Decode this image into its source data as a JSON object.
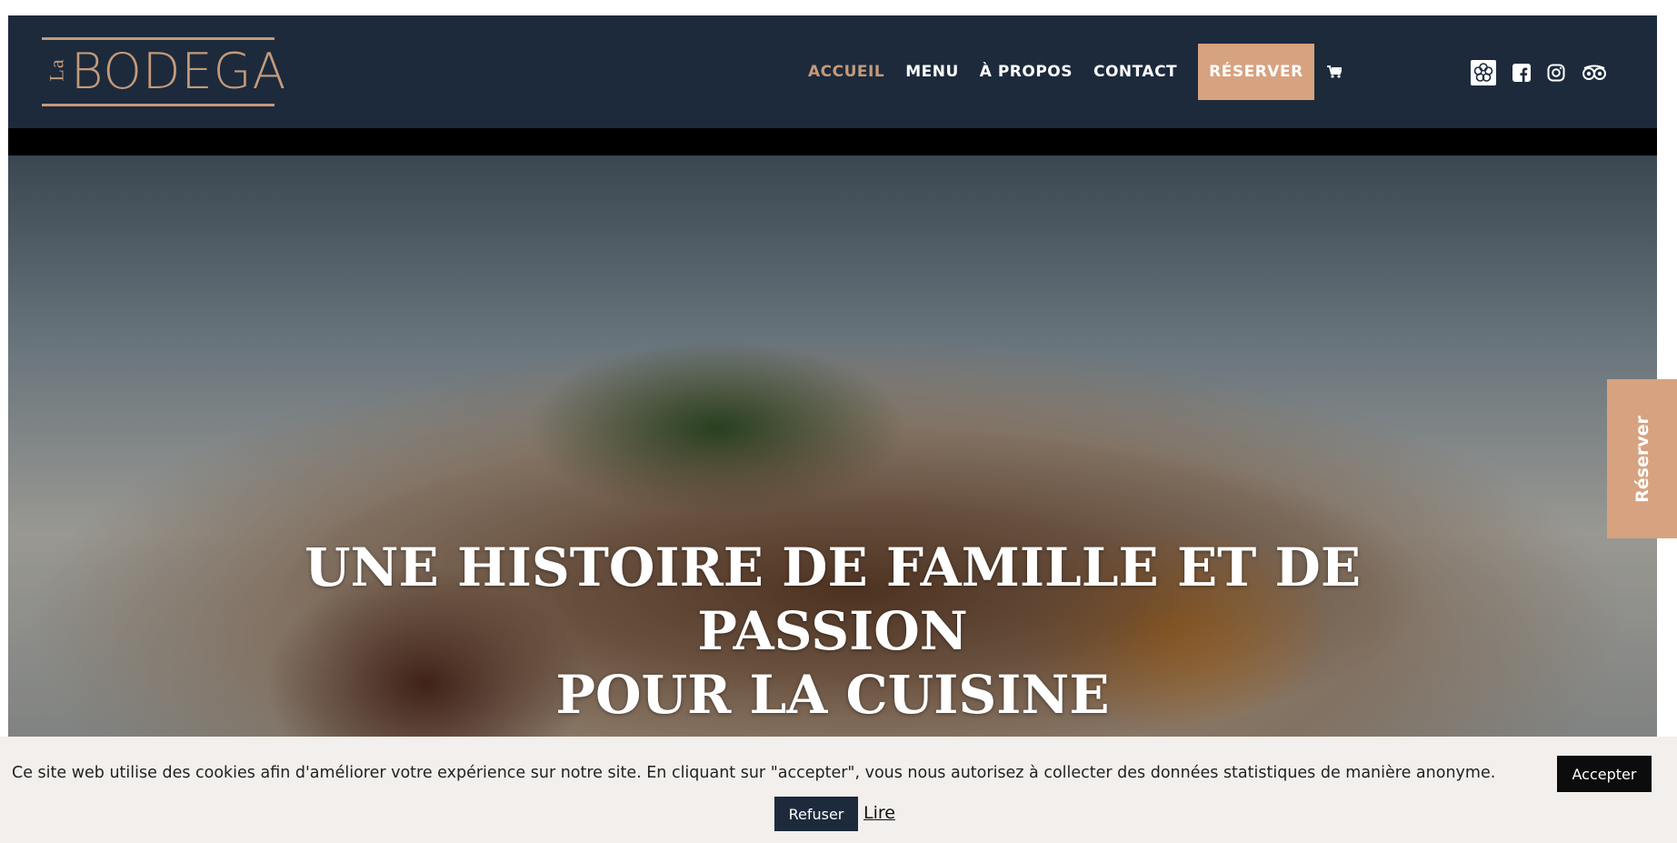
{
  "header": {
    "logo": {
      "prefix": "La",
      "name": "BODEGA"
    },
    "nav": {
      "items": [
        {
          "label": "ACCUEIL"
        },
        {
          "label": "MENU"
        },
        {
          "label": "À PROPOS"
        },
        {
          "label": "CONTACT"
        }
      ],
      "reserve_label": "RÉSERVER",
      "cart_icon": "cart-icon"
    },
    "social_icons": [
      "michelin-flower-icon",
      "facebook-icon",
      "instagram-icon",
      "tripadvisor-icon"
    ]
  },
  "hero": {
    "title_line1": "UNE HISTOIRE DE FAMILLE ET DE PASSION",
    "title_line2": "POUR LA CUISINE"
  },
  "side_tab": {
    "label": "Réserver"
  },
  "cookie_bar": {
    "text": "Ce site web utilise des cookies afin d'améliorer votre expérience sur notre site. En cliquant sur \"accepter\", vous nous autorisez à collecter des données statistiques de manière anonyme.",
    "accept_label": "Accepter",
    "refuse_label": "Refuser",
    "read_label": "Lire"
  },
  "colors": {
    "header_bg": "#1c2a3c",
    "accent": "#d7a27f",
    "logo_gold": "#c49a7a",
    "cookie_bg": "#f2efec"
  }
}
